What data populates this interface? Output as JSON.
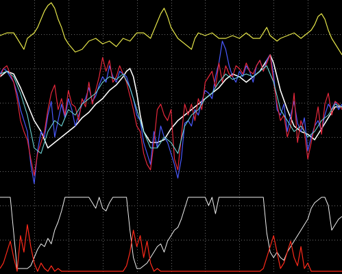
{
  "chart_data": [
    {
      "type": "line",
      "grid": true,
      "background": "#000000",
      "grid_color": "#6e6e6e",
      "x_range": [
        0,
        100
      ],
      "y_range": [
        0,
        100
      ],
      "series": [
        {
          "key": "yellow",
          "color": "#e6e64a",
          "stroke_width": 1.2,
          "x": [
            0,
            2,
            4,
            5,
            6,
            7,
            8,
            10,
            11,
            12,
            13,
            14,
            15,
            16,
            17,
            18,
            19,
            20,
            22,
            24,
            26,
            28,
            30,
            32,
            34,
            36,
            38,
            40,
            42,
            44,
            46,
            47,
            48,
            49,
            50,
            51,
            52,
            53,
            54,
            55,
            56,
            57,
            58,
            60,
            62,
            64,
            66,
            68,
            70,
            72,
            74,
            76,
            78,
            79,
            80,
            81,
            82,
            84,
            86,
            88,
            90,
            91,
            92,
            93,
            94,
            95,
            96,
            97,
            98,
            99,
            100
          ],
          "y": [
            87,
            88,
            88,
            86,
            84,
            82,
            86,
            88,
            90,
            93,
            96,
            98,
            99,
            97,
            93,
            90,
            86,
            84,
            81,
            82,
            85,
            86,
            84,
            85,
            83,
            86,
            85,
            88,
            88,
            86,
            92,
            95,
            97,
            94,
            90,
            88,
            86,
            85,
            84,
            83,
            82,
            86,
            88,
            87,
            88,
            86,
            86,
            87,
            86,
            88,
            86,
            86,
            90,
            87,
            86,
            85,
            86,
            87,
            88,
            86,
            88,
            89,
            91,
            94,
            95,
            93,
            89,
            86,
            84,
            82,
            80
          ]
        },
        {
          "key": "white-top",
          "color": "#ffffff",
          "stroke_width": 1.6,
          "x": [
            0,
            2,
            4,
            6,
            8,
            10,
            12,
            14,
            16,
            18,
            20,
            22,
            24,
            26,
            28,
            30,
            32,
            34,
            36,
            37,
            38,
            39,
            40,
            41,
            42,
            44,
            46,
            48,
            50,
            52,
            54,
            56,
            58,
            60,
            62,
            64,
            66,
            68,
            70,
            72,
            74,
            76,
            78,
            79,
            80,
            81,
            82,
            84,
            86,
            88,
            90,
            92,
            94,
            96,
            98,
            100
          ],
          "y": [
            72,
            74,
            73,
            68,
            62,
            56,
            52,
            46,
            48,
            50,
            52,
            54,
            57,
            59,
            62,
            64,
            67,
            69,
            72,
            74,
            75,
            72,
            66,
            58,
            52,
            48,
            48,
            49,
            53,
            56,
            58,
            60,
            62,
            64,
            66,
            68,
            71,
            73,
            72,
            70,
            72,
            74,
            78,
            80,
            77,
            72,
            67,
            60,
            54,
            52,
            51,
            49,
            53,
            57,
            61,
            61
          ]
        },
        {
          "key": "blue",
          "color": "#4a5aff",
          "stroke_width": 1.2,
          "x": [
            0,
            1,
            2,
            3,
            4,
            5,
            6,
            7,
            8,
            9,
            10,
            11,
            12,
            13,
            14,
            15,
            16,
            17,
            18,
            19,
            20,
            21,
            22,
            23,
            24,
            25,
            26,
            27,
            28,
            29,
            30,
            31,
            32,
            33,
            34,
            35,
            36,
            37,
            38,
            39,
            40,
            41,
            42,
            43,
            44,
            45,
            46,
            47,
            48,
            49,
            50,
            51,
            52,
            53,
            54,
            55,
            56,
            57,
            58,
            59,
            60,
            61,
            62,
            63,
            64,
            65,
            66,
            67,
            68,
            69,
            70,
            71,
            72,
            73,
            74,
            75,
            76,
            77,
            78,
            79,
            80,
            81,
            82,
            83,
            84,
            85,
            86,
            87,
            88,
            89,
            90,
            91,
            92,
            93,
            94,
            95,
            96,
            97,
            98,
            99,
            100
          ],
          "y": [
            73,
            75,
            74,
            72,
            70,
            66,
            60,
            56,
            52,
            40,
            33,
            45,
            52,
            50,
            58,
            63,
            50,
            56,
            62,
            57,
            64,
            60,
            54,
            58,
            62,
            64,
            68,
            63,
            65,
            69,
            72,
            70,
            76,
            72,
            70,
            74,
            73,
            72,
            68,
            64,
            58,
            56,
            48,
            44,
            40,
            52,
            46,
            54,
            50,
            48,
            44,
            40,
            35,
            42,
            55,
            56,
            54,
            60,
            58,
            63,
            67,
            66,
            64,
            72,
            77,
            85,
            82,
            76,
            72,
            70,
            74,
            72,
            76,
            74,
            70,
            76,
            78,
            74,
            78,
            80,
            73,
            60,
            58,
            62,
            52,
            58,
            63,
            55,
            52,
            57,
            45,
            50,
            54,
            56,
            52,
            58,
            62,
            60,
            63,
            60,
            62
          ]
        },
        {
          "key": "red",
          "color": "#e8283c",
          "stroke_width": 1.2,
          "x": [
            0,
            1,
            2,
            3,
            4,
            5,
            6,
            7,
            8,
            9,
            10,
            11,
            12,
            13,
            14,
            15,
            16,
            17,
            18,
            19,
            20,
            21,
            22,
            23,
            24,
            25,
            26,
            27,
            28,
            29,
            30,
            31,
            32,
            33,
            34,
            35,
            36,
            37,
            38,
            39,
            40,
            41,
            42,
            43,
            44,
            45,
            46,
            47,
            48,
            49,
            50,
            51,
            52,
            53,
            54,
            55,
            56,
            57,
            58,
            59,
            60,
            61,
            62,
            63,
            64,
            65,
            66,
            67,
            68,
            69,
            70,
            71,
            72,
            73,
            74,
            75,
            76,
            77,
            78,
            79,
            80,
            81,
            82,
            83,
            84,
            85,
            86,
            87,
            88,
            89,
            90,
            91,
            92,
            93,
            94,
            95,
            96,
            97,
            98,
            99,
            100
          ],
          "y": [
            72,
            75,
            76,
            73,
            70,
            64,
            56,
            52,
            49,
            42,
            36,
            44,
            48,
            52,
            60,
            66,
            69,
            60,
            64,
            58,
            67,
            62,
            61,
            56,
            64,
            61,
            70,
            62,
            67,
            72,
            79,
            74,
            78,
            70,
            72,
            76,
            73,
            70,
            65,
            60,
            54,
            52,
            44,
            40,
            38,
            48,
            60,
            62,
            58,
            56,
            60,
            42,
            38,
            50,
            62,
            58,
            62,
            56,
            64,
            60,
            70,
            72,
            74,
            68,
            77,
            70,
            76,
            73,
            72,
            76,
            75,
            73,
            77,
            74,
            73,
            76,
            78,
            74,
            77,
            80,
            70,
            62,
            56,
            58,
            50,
            54,
            66,
            48,
            56,
            52,
            42,
            48,
            54,
            61,
            51,
            62,
            66,
            58,
            63,
            62,
            60
          ]
        },
        {
          "key": "cyan",
          "color": "#6ed8d8",
          "stroke_width": 1.1,
          "x": [
            0,
            2,
            4,
            6,
            8,
            10,
            12,
            14,
            16,
            18,
            20,
            22,
            24,
            26,
            28,
            30,
            32,
            34,
            36,
            38,
            40,
            42,
            44,
            46,
            48,
            50,
            52,
            54,
            56,
            58,
            60,
            62,
            64,
            66,
            68,
            70,
            72,
            74,
            76,
            78,
            80,
            82,
            84,
            86,
            88,
            90,
            92,
            94,
            96,
            98,
            100
          ],
          "y": [
            73,
            74,
            72,
            66,
            58,
            46,
            44,
            52,
            56,
            54,
            60,
            58,
            62,
            64,
            66,
            70,
            72,
            71,
            73,
            68,
            60,
            52,
            46,
            46,
            50,
            48,
            44,
            54,
            58,
            60,
            64,
            66,
            70,
            73,
            71,
            72,
            73,
            72,
            74,
            76,
            70,
            60,
            56,
            52,
            54,
            50,
            52,
            56,
            58,
            62,
            61
          ]
        },
        {
          "key": "white-bottom",
          "color": "#f0f0f0",
          "stroke_width": 1.0,
          "x": [
            0,
            1,
            2,
            3,
            4,
            5,
            6,
            7,
            8,
            9,
            10,
            11,
            12,
            13,
            14,
            15,
            16,
            17,
            18,
            19,
            20,
            21,
            22,
            23,
            24,
            25,
            26,
            27,
            28,
            29,
            30,
            31,
            32,
            33,
            34,
            35,
            36,
            37,
            38,
            39,
            40,
            41,
            42,
            43,
            44,
            45,
            46,
            47,
            48,
            49,
            50,
            51,
            52,
            53,
            54,
            55,
            56,
            57,
            58,
            59,
            60,
            61,
            62,
            63,
            64,
            65,
            66,
            67,
            68,
            69,
            70,
            71,
            72,
            73,
            74,
            75,
            76,
            77,
            78,
            79,
            80,
            81,
            82,
            83,
            84,
            85,
            86,
            87,
            88,
            89,
            90,
            91,
            92,
            93,
            94,
            95,
            96,
            97,
            98,
            99,
            100
          ],
          "y": [
            28,
            28,
            28,
            28,
            15,
            2,
            2,
            2,
            2,
            3,
            6,
            9,
            11,
            10,
            13,
            11,
            16,
            19,
            23,
            28,
            28,
            28,
            28,
            28,
            28,
            28,
            28,
            26,
            24,
            28,
            24,
            23,
            26,
            28,
            28,
            28,
            28,
            28,
            16,
            6,
            2,
            2,
            3,
            4,
            6,
            8,
            10,
            11,
            8,
            12,
            14,
            16,
            17,
            20,
            24,
            28,
            28,
            28,
            28,
            28,
            28,
            25,
            28,
            22,
            28,
            28,
            28,
            28,
            28,
            28,
            28,
            28,
            28,
            28,
            28,
            28,
            28,
            28,
            15,
            8,
            6,
            8,
            6,
            5,
            8,
            10,
            12,
            14,
            16,
            18,
            20,
            24,
            26,
            27,
            28,
            28,
            25,
            16,
            18,
            20,
            21
          ]
        },
        {
          "key": "red-bottom",
          "color": "#ff2a1a",
          "stroke_width": 1.2,
          "x": [
            0,
            1,
            2,
            3,
            4,
            5,
            6,
            7,
            8,
            9,
            10,
            11,
            12,
            13,
            14,
            15,
            16,
            17,
            18,
            19,
            20,
            36,
            37,
            38,
            39,
            40,
            41,
            42,
            43,
            44,
            45,
            46,
            47,
            76,
            77,
            78,
            79,
            80,
            81,
            82,
            83,
            84,
            85,
            86,
            87,
            88,
            89,
            90,
            91,
            100
          ],
          "y": [
            2,
            4,
            8,
            12,
            6,
            1,
            14,
            8,
            18,
            10,
            4,
            1,
            4,
            2,
            1,
            3,
            1,
            2,
            1,
            1,
            1,
            1,
            3,
            8,
            16,
            10,
            14,
            6,
            12,
            4,
            1,
            2,
            1,
            1,
            2,
            6,
            10,
            14,
            8,
            2,
            4,
            8,
            12,
            6,
            3,
            10,
            2,
            4,
            1,
            1
          ]
        }
      ]
    }
  ]
}
